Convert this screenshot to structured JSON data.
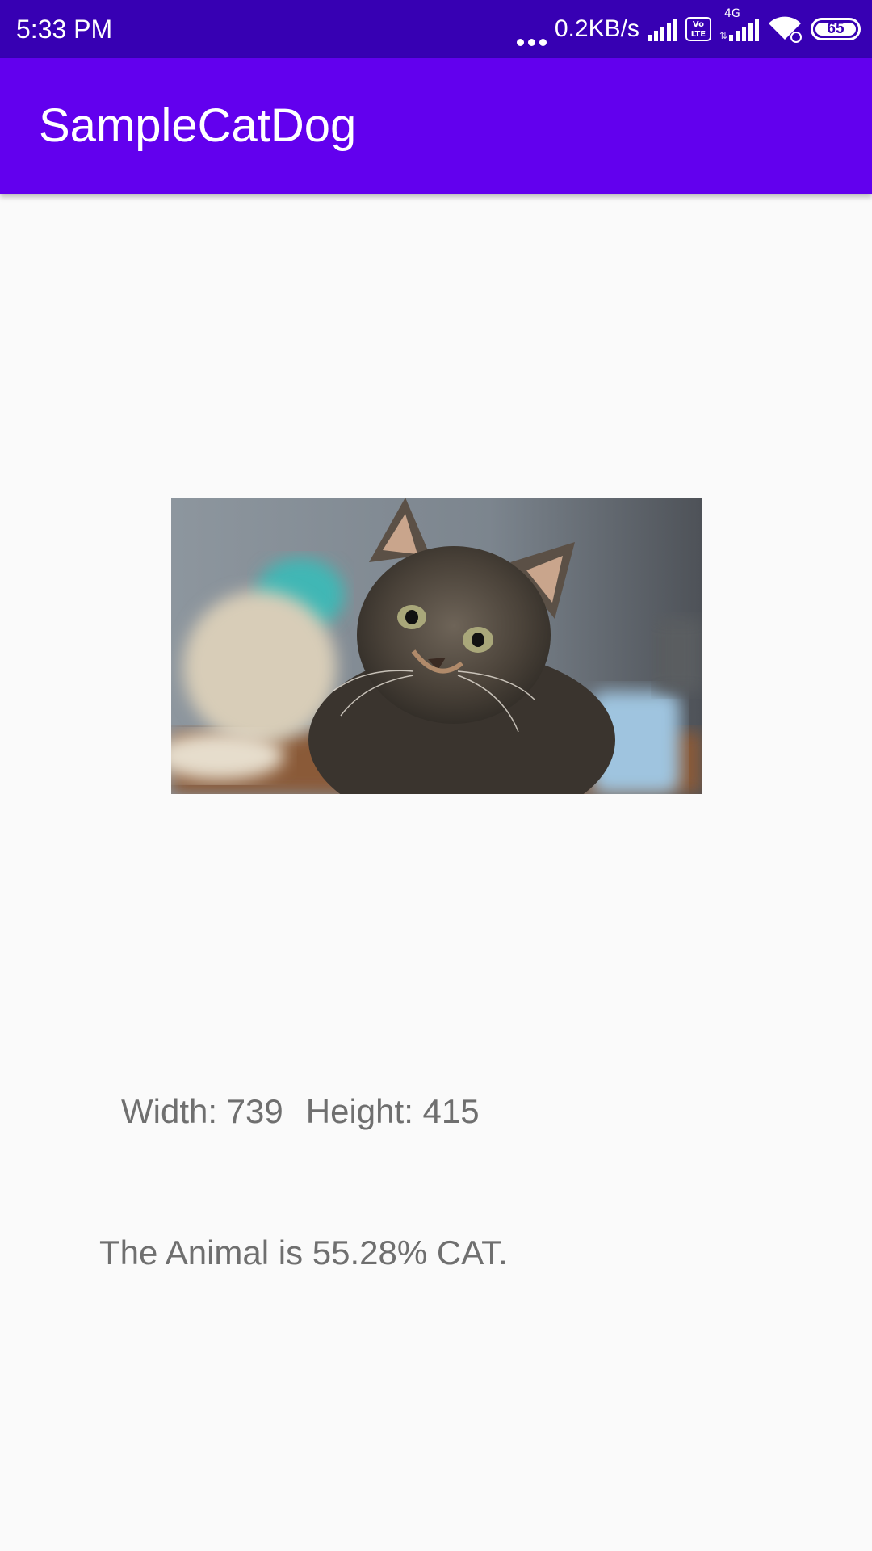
{
  "status_bar": {
    "time": "5:33 PM",
    "net_speed": "0.2KB/s",
    "volte_label": "Vo\nLTE",
    "network_type": "4G",
    "battery_level": "65",
    "icons": [
      "dots-icon",
      "signal-icon",
      "volte-icon",
      "signal-4g-icon",
      "wifi-icon",
      "battery-icon"
    ]
  },
  "app_bar": {
    "title": "SampleCatDog",
    "color": "#6200ee"
  },
  "status_bar_color": "#3700b3",
  "image": {
    "alt": "kitten photo"
  },
  "dimensions": {
    "width_label": "Width: 739",
    "height_label": "Height: 415"
  },
  "result": {
    "text": "The Animal is 55.28% CAT."
  }
}
